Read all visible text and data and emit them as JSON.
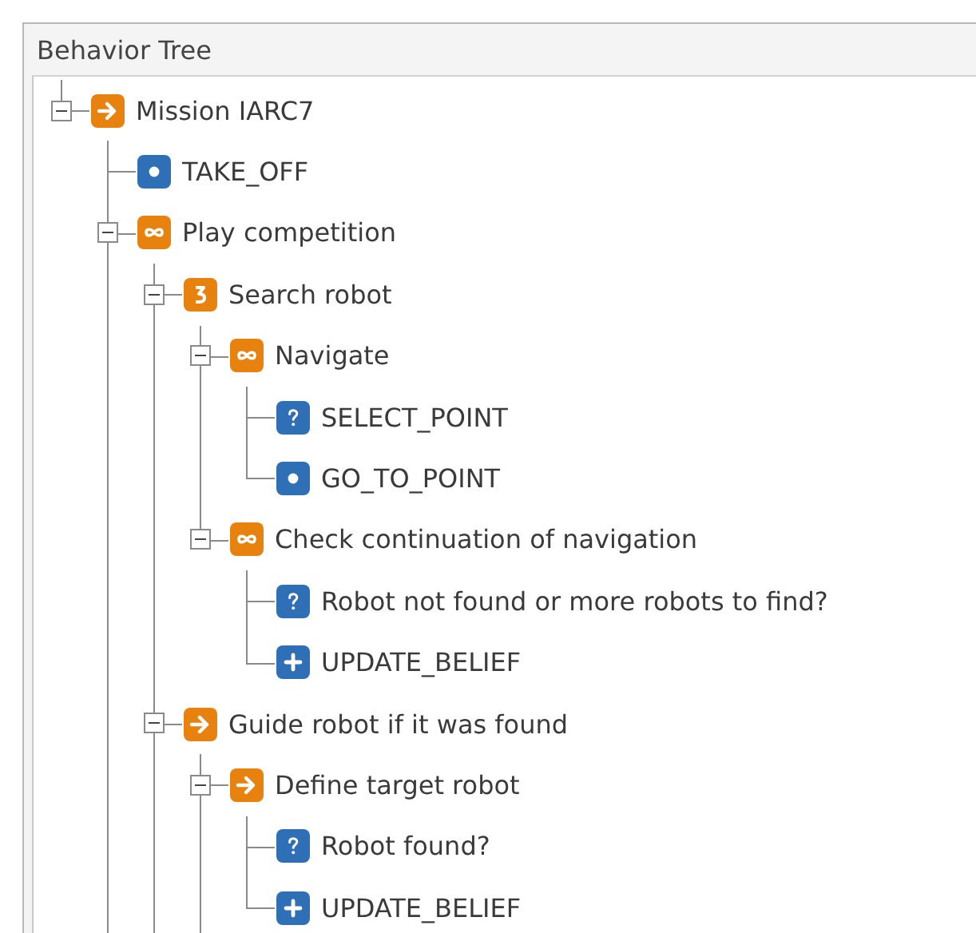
{
  "panel": {
    "title": "Behavior Tree"
  },
  "tree": [
    {
      "label": "Mission IARC7",
      "kind": "sequence",
      "expanded": true,
      "last": true,
      "children": [
        {
          "label": "TAKE_OFF",
          "kind": "action",
          "last": false
        },
        {
          "label": "Play competition",
          "kind": "parallel",
          "expanded": true,
          "last": false,
          "children": [
            {
              "label": "Search robot",
              "kind": "selector",
              "expanded": true,
              "last": false,
              "children": [
                {
                  "label": "Navigate",
                  "kind": "parallel",
                  "expanded": true,
                  "last": false,
                  "children": [
                    {
                      "label": "SELECT_POINT",
                      "kind": "condition",
                      "last": false
                    },
                    {
                      "label": "GO_TO_POINT",
                      "kind": "action",
                      "last": true
                    }
                  ]
                },
                {
                  "label": "Check continuation of navigation",
                  "kind": "parallel",
                  "expanded": true,
                  "last": true,
                  "children": [
                    {
                      "label": "Robot not found or more robots to find?",
                      "kind": "condition",
                      "last": false
                    },
                    {
                      "label": "UPDATE_BELIEF",
                      "kind": "add",
                      "last": true
                    }
                  ]
                }
              ]
            },
            {
              "label": "Guide robot if it was found",
              "kind": "sequence",
              "expanded": true,
              "last": false,
              "children": [
                {
                  "label": "Define target robot",
                  "kind": "sequence",
                  "expanded": true,
                  "last": false,
                  "children": [
                    {
                      "label": "Robot found?",
                      "kind": "condition",
                      "last": false
                    },
                    {
                      "label": "UPDATE_BELIEF",
                      "kind": "add",
                      "last": true
                    }
                  ]
                }
              ]
            }
          ]
        }
      ]
    }
  ]
}
